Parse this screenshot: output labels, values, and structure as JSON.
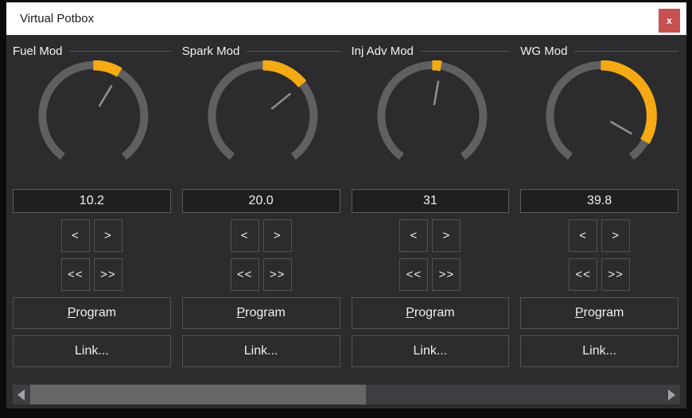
{
  "window": {
    "title": "Virtual Potbox",
    "close_glyph": "x"
  },
  "colors": {
    "accent_orange": "#F5AA14",
    "arc_gray": "#606062",
    "needle_gray": "#909092",
    "titlebar_bg": "#FFFFFF",
    "client_bg": "#2C2C2E",
    "close_red": "#C75050"
  },
  "pots": [
    {
      "name": "Fuel Mod",
      "value": "10.2",
      "sweep_deg": 31
    },
    {
      "name": "Spark Mod",
      "value": "20.0",
      "sweep_deg": 51
    },
    {
      "name": "Inj Adv Mod",
      "value": "31",
      "sweep_deg": 10
    },
    {
      "name": "WG Mod",
      "value": "39.8",
      "sweep_deg": 120
    }
  ],
  "controls": {
    "step_down": "<",
    "step_up": ">",
    "step_down_fast": "<<",
    "step_up_fast": ">>",
    "program_accel": "P",
    "program_rest": "rogram",
    "link_label": "Link..."
  }
}
